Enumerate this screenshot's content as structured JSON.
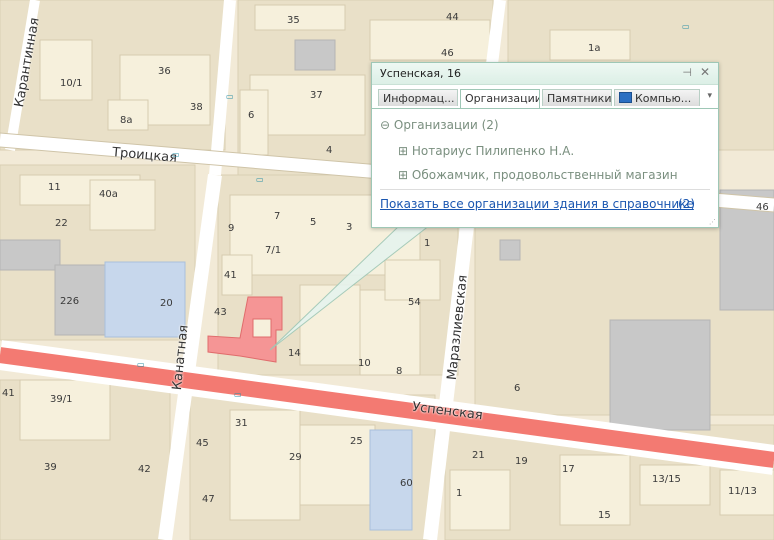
{
  "map": {
    "colors": {
      "background": "#f2ead7",
      "block": "#e9e0c8",
      "building": "#f6f0dc",
      "road": "#ffffff",
      "main_road": "#f37a72",
      "highlight": "#f59595",
      "gray_building": "#c8c8c8",
      "blue_building": "#c7d7ec",
      "park": "#cfe8b4"
    },
    "streets": [
      {
        "id": "troitskaya",
        "label": "Троицкая"
      },
      {
        "id": "karantinnaya",
        "label": "Карантинная"
      },
      {
        "id": "kanatnaya",
        "label": "Канатная"
      },
      {
        "id": "marazlievskaya",
        "label": "Маразлиевская"
      },
      {
        "id": "uspenskaya",
        "label": "Успенская"
      }
    ],
    "house_numbers": [
      "35",
      "44",
      "46",
      "1a",
      "10/1",
      "36",
      "38",
      "37",
      "8a",
      "6",
      "4",
      "11",
      "40a",
      "22",
      "226",
      "20",
      "7",
      "5",
      "3",
      "9",
      "7/1",
      "1",
      "41",
      "43",
      "14",
      "10",
      "8",
      "54",
      "6",
      "39/1",
      "31",
      "25",
      "45",
      "29",
      "39",
      "42",
      "60",
      "21",
      "19",
      "17",
      "13/15",
      "11/13",
      "1",
      "47",
      "15",
      "41",
      "46"
    ]
  },
  "popup": {
    "title": "Успенская, 16",
    "pin_icon": "pin-icon",
    "close_icon": "close-icon",
    "tabs": [
      {
        "label": "Информац...",
        "active": false
      },
      {
        "label": "Организации",
        "active": true
      },
      {
        "label": "Памятники",
        "active": false
      },
      {
        "label": "Компью...",
        "active": false,
        "icon": "computer-icon"
      }
    ],
    "tree": {
      "root": {
        "toggle": "⊖",
        "label": "Организации",
        "count": "(2)"
      },
      "items": [
        {
          "toggle": "⊞",
          "label": "Нотариус Пилипенко Н.А."
        },
        {
          "toggle": "⊞",
          "label": "Обожамчик, продовольственный магазин"
        }
      ]
    },
    "show_all_link": "Показать все организации здания в справочнике",
    "show_all_count": "(2)"
  }
}
